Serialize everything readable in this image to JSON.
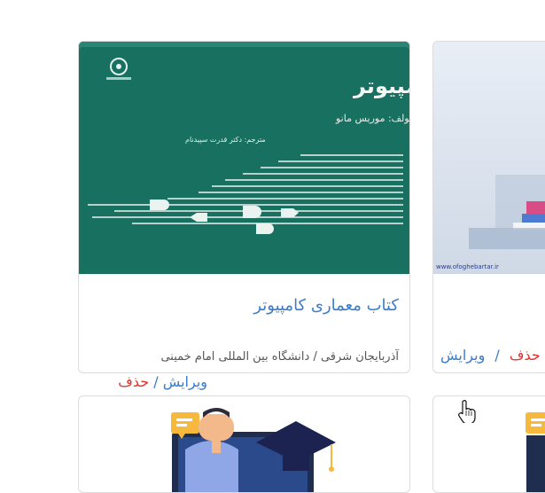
{
  "books": [
    {
      "cover_title": "معماری کامپیوتر",
      "cover_author": "مولف: موریس مانو",
      "cover_translator": "مترجم: دکتر قدرت سپیدنام",
      "title": "کتاب معماری کامپیوتر",
      "meta": "آذربایجان شرقی / دانشگاه بین المللی امام خمینی",
      "edit_label": "ویرایش",
      "separator": "/",
      "delete_label": "حذف"
    },
    {
      "cover_watermark": "www.ofoghebartar.ir",
      "edit_label": "ویرایش",
      "separator": "/",
      "delete_label": "حذف"
    }
  ],
  "colors": {
    "link": "#3a7cc7",
    "delete": "#e0342d",
    "cover_green": "#16705f",
    "card_border": "#dcdcdc"
  },
  "icons": [
    "pointer-hand-icon",
    "chat-bubble-icon",
    "graduation-cap-icon",
    "book-logo-icon"
  ]
}
